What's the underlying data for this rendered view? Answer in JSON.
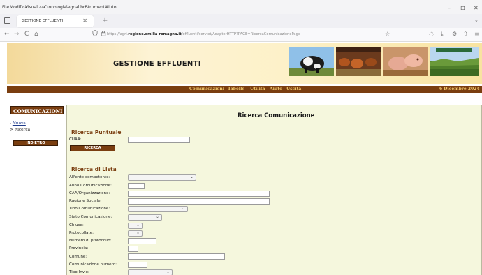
{
  "browser": {
    "menu": [
      "File",
      "Modifica",
      "Visualizza",
      "Cronologia",
      "Segnalibri",
      "Strumenti",
      "Aiuto"
    ],
    "window_controls": [
      "–",
      "⊡",
      "✕"
    ],
    "tab_title": "GESTIONE EFFLUENTI",
    "tab_close": "✕",
    "new_tab": "+",
    "url_prefix": "https://agri.",
    "url_domain": "regione.emilia-romagna.it",
    "url_rest": "/effluenti/servlet/AdapterHTTP?PAGE=RicercaComunicazionePage",
    "bookmark_star": "☆",
    "nav_back": "←",
    "nav_forward": "→",
    "nav_reload": "C",
    "nav_home": "⌂",
    "tools": [
      "◌",
      "⤓",
      "⚙",
      "⇧",
      "≡"
    ],
    "tabs_chevron": "⌄"
  },
  "header": {
    "title": "GESTIONE EFFLUENTI"
  },
  "nav": {
    "links": [
      "Comunicazioni",
      "Tabelle",
      "Utilità",
      "Aiuto",
      "Uscita"
    ],
    "separator": "-",
    "date": "6 Dicembre 2024"
  },
  "sidebar": {
    "title": "COMUNICAZIONI",
    "items": [
      {
        "prefix": "-",
        "label": "Nuova"
      },
      {
        "prefix": ">",
        "label": "Ricerca"
      }
    ],
    "back_button": "INDIETRO"
  },
  "main": {
    "title": "Ricerca Comunicazione",
    "puntuale": {
      "heading": "Ricerca Puntuale",
      "cuaa_label": "CUAA:",
      "cuaa_value": "",
      "search_button": "RICERCA"
    },
    "lista": {
      "heading": "Ricerca di Lista",
      "fields": [
        {
          "label": "All'ente competente:",
          "type": "select",
          "value": ""
        },
        {
          "label": "Anno Comunicazione:",
          "type": "input",
          "value": ""
        },
        {
          "label": "CAA/Organizzazione:",
          "type": "input",
          "value": ""
        },
        {
          "label": "Ragione Sociale:",
          "type": "input",
          "value": ""
        },
        {
          "label": "Tipo Comunicazione:",
          "type": "select",
          "value": ""
        },
        {
          "label": "Stato Comunicazione:",
          "type": "select",
          "value": ""
        },
        {
          "label": "Chiuse:",
          "type": "select",
          "value": ""
        },
        {
          "label": "Protocollate:",
          "type": "select",
          "value": ""
        },
        {
          "label": "Numero di protocollo:",
          "type": "input",
          "value": ""
        },
        {
          "label": "Provincia:",
          "type": "input",
          "value": ""
        },
        {
          "label": "Comune:",
          "type": "input",
          "value": ""
        },
        {
          "label": "Comunicazione numero:",
          "type": "input",
          "value": ""
        },
        {
          "label": "Tipo Invio:",
          "type": "select",
          "value": ""
        }
      ]
    }
  },
  "colors": {
    "brown": "#7a3e10",
    "nav_link": "#f3c96d",
    "form_bg": "#f5f7dd"
  }
}
